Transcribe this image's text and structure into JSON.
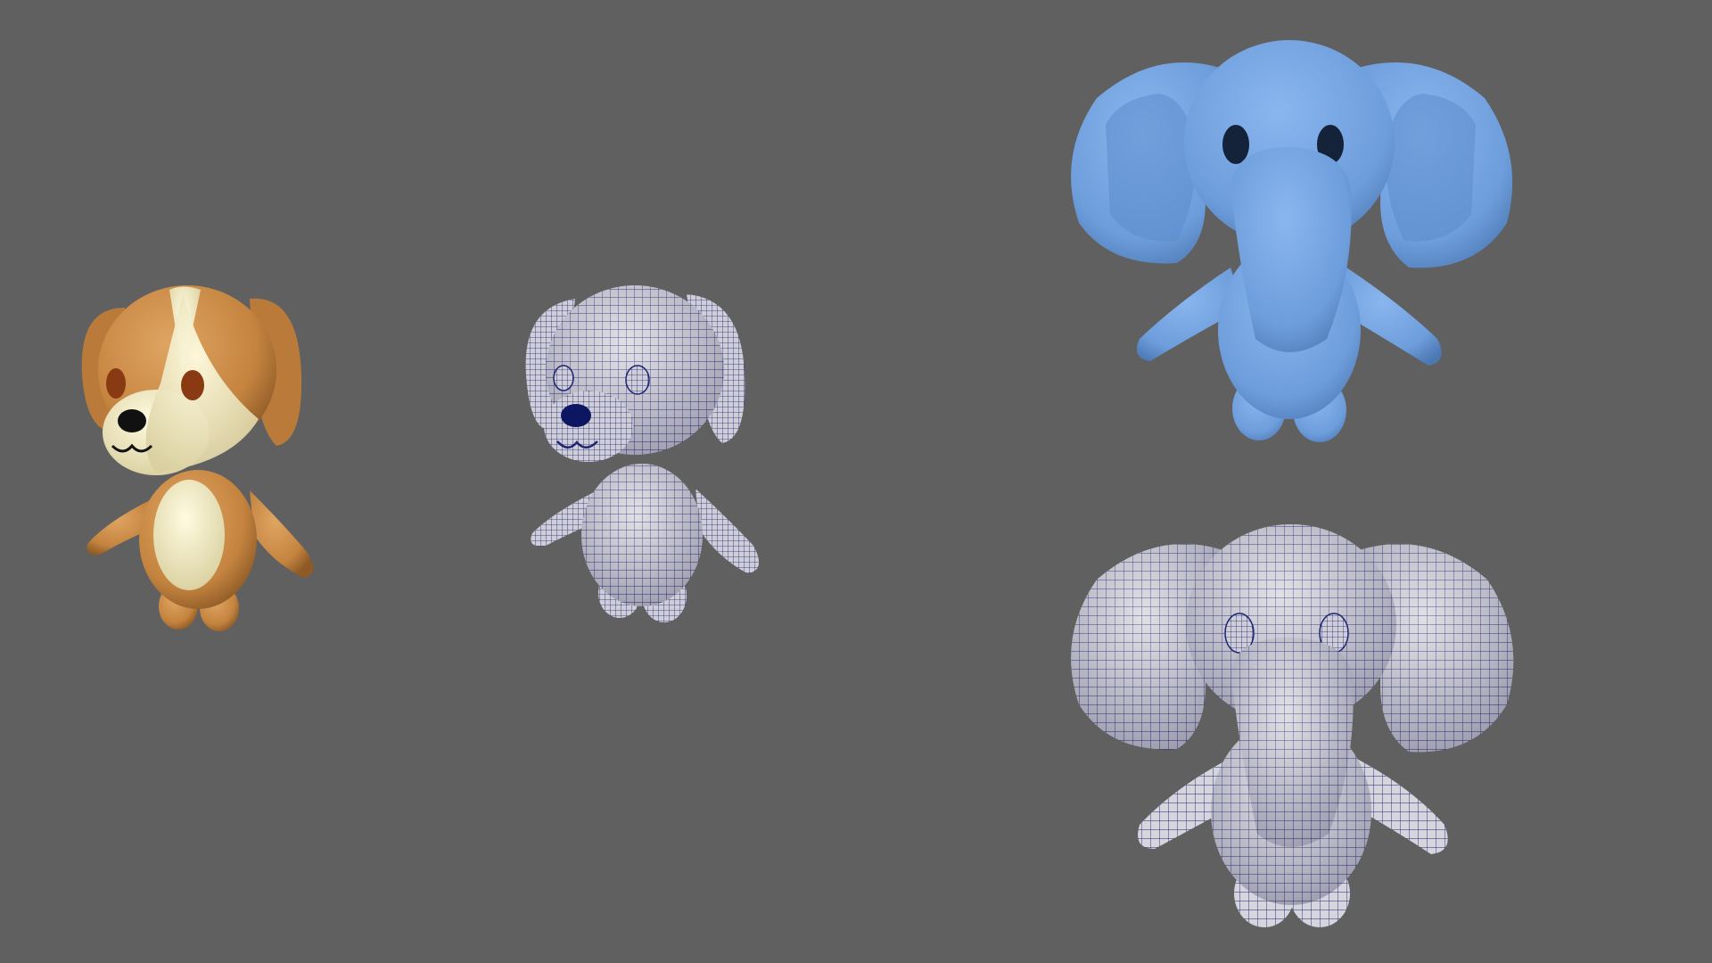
{
  "viewport": {
    "background_color": "#606060"
  },
  "models": [
    {
      "name": "dog",
      "display": "shaded",
      "colors": {
        "body": "#c98a45",
        "patch": "#f3ecc4",
        "eye": "#8a3a12",
        "nose": "#111111"
      }
    },
    {
      "name": "dog",
      "display": "wireframe-on-shaded",
      "colors": {
        "surface": "#d9d6df",
        "wire": "#1c2470"
      }
    },
    {
      "name": "elephant",
      "display": "shaded",
      "colors": {
        "body": "#6f9fdc",
        "eye": "#14233a"
      }
    },
    {
      "name": "elephant",
      "display": "wireframe-on-shaded",
      "colors": {
        "surface": "#d5d4dc",
        "wire": "#1c2470"
      }
    }
  ]
}
